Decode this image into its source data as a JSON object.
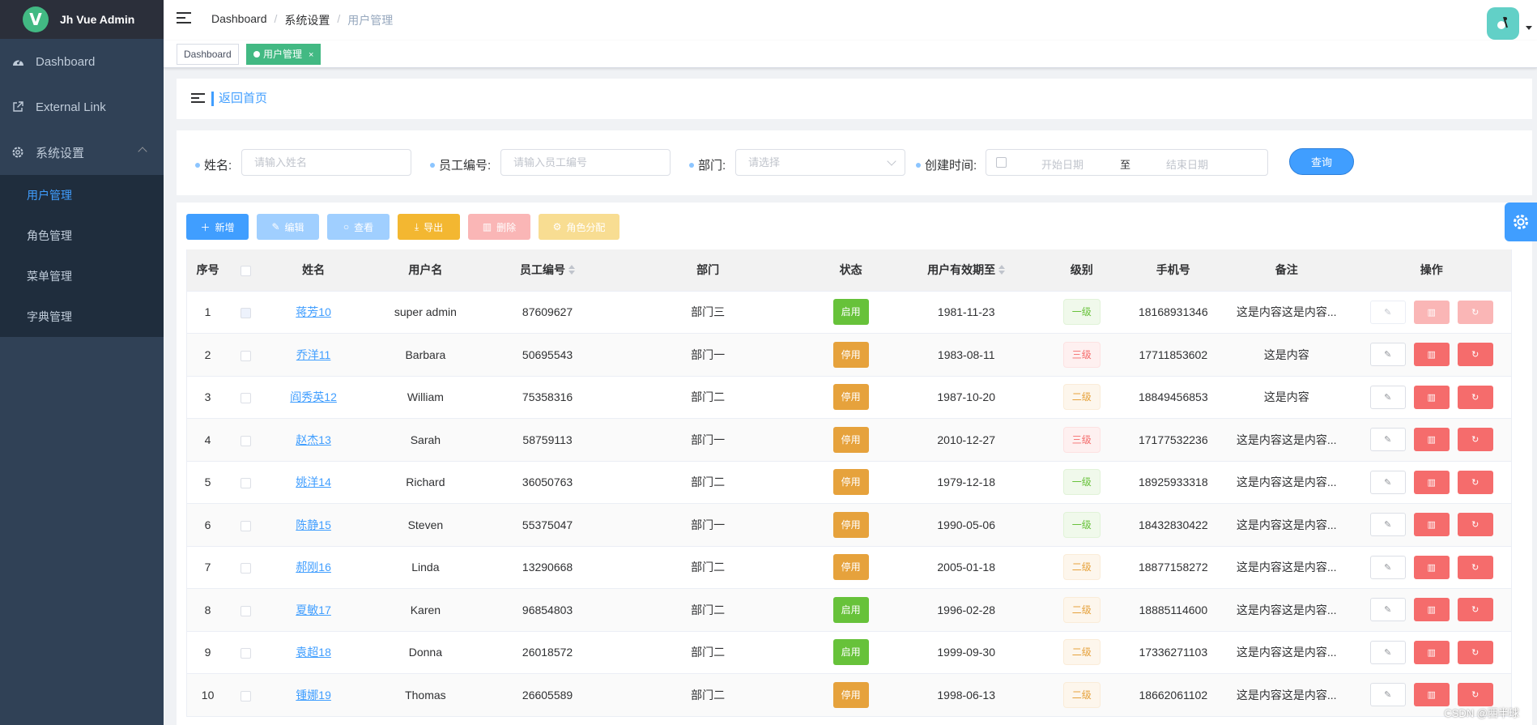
{
  "app": {
    "title": "Jh Vue Admin",
    "logo_letter": "V"
  },
  "sidebar": {
    "items": [
      {
        "label": "Dashboard",
        "icon": "dashboard-icon"
      },
      {
        "label": "External Link",
        "icon": "external-link-icon"
      },
      {
        "label": "系统设置",
        "icon": "gear-icon",
        "expanded": true
      }
    ],
    "submenu": [
      {
        "label": "用户管理",
        "active": true
      },
      {
        "label": "角色管理"
      },
      {
        "label": "菜单管理"
      },
      {
        "label": "字典管理"
      }
    ]
  },
  "header": {
    "breadcrumb": [
      "Dashboard",
      "系统设置",
      "用户管理"
    ]
  },
  "tags": [
    {
      "label": "Dashboard",
      "active": false
    },
    {
      "label": "用户管理",
      "active": true,
      "close": "×"
    }
  ],
  "back": {
    "label": "返回首页"
  },
  "filters": {
    "name": {
      "label": "姓名:",
      "placeholder": "请输入姓名"
    },
    "emp_no": {
      "label": "员工编号:",
      "placeholder": "请输入员工编号"
    },
    "dept": {
      "label": "部门:",
      "placeholder": "请选择"
    },
    "created": {
      "label": "创建时间:",
      "start": "开始日期",
      "sep": "至",
      "end": "结束日期"
    },
    "query_label": "查询"
  },
  "toolbar": {
    "add": "新增",
    "edit": "编辑",
    "view": "查看",
    "export": "导出",
    "delete": "删除",
    "role": "角色分配"
  },
  "colors": {
    "primary": "#409eff",
    "success": "#67c23a",
    "warning": "#e6a23c",
    "danger": "#f56c6c",
    "tag_active": "#42b983",
    "sidebar": "#304156"
  },
  "table": {
    "headers": [
      "序号",
      "",
      "姓名",
      "用户名",
      "员工编号",
      "部门",
      "状态",
      "用户有效期至",
      "级别",
      "手机号",
      "备注",
      "操作"
    ],
    "rows": [
      {
        "idx": "1",
        "name": "蒋芳10",
        "username": "super admin",
        "emp": "87609627",
        "dept": "部门三",
        "status": "启用",
        "expire": "1981-11-23",
        "level": "一级",
        "phone": "18168931346",
        "note": "这是内容这是内容..."
      },
      {
        "idx": "2",
        "name": "乔洋11",
        "username": "Barbara",
        "emp": "50695543",
        "dept": "部门一",
        "status": "停用",
        "expire": "1983-08-11",
        "level": "三级",
        "phone": "17711853602",
        "note": "这是内容"
      },
      {
        "idx": "3",
        "name": "阎秀英12",
        "username": "William",
        "emp": "75358316",
        "dept": "部门二",
        "status": "停用",
        "expire": "1987-10-20",
        "level": "二级",
        "phone": "18849456853",
        "note": "这是内容"
      },
      {
        "idx": "4",
        "name": "赵杰13",
        "username": "Sarah",
        "emp": "58759113",
        "dept": "部门一",
        "status": "停用",
        "expire": "2010-12-27",
        "level": "三级",
        "phone": "17177532236",
        "note": "这是内容这是内容..."
      },
      {
        "idx": "5",
        "name": "姚洋14",
        "username": "Richard",
        "emp": "36050763",
        "dept": "部门二",
        "status": "停用",
        "expire": "1979-12-18",
        "level": "一级",
        "phone": "18925933318",
        "note": "这是内容这是内容..."
      },
      {
        "idx": "6",
        "name": "陈静15",
        "username": "Steven",
        "emp": "55375047",
        "dept": "部门一",
        "status": "停用",
        "expire": "1990-05-06",
        "level": "一级",
        "phone": "18432830422",
        "note": "这是内容这是内容..."
      },
      {
        "idx": "7",
        "name": "郝刚16",
        "username": "Linda",
        "emp": "13290668",
        "dept": "部门二",
        "status": "停用",
        "expire": "2005-01-18",
        "level": "二级",
        "phone": "18877158272",
        "note": "这是内容这是内容..."
      },
      {
        "idx": "8",
        "name": "夏敏17",
        "username": "Karen",
        "emp": "96854803",
        "dept": "部门二",
        "status": "启用",
        "expire": "1996-02-28",
        "level": "二级",
        "phone": "18885114600",
        "note": "这是内容这是内容..."
      },
      {
        "idx": "9",
        "name": "袁超18",
        "username": "Donna",
        "emp": "26018572",
        "dept": "部门二",
        "status": "启用",
        "expire": "1999-09-30",
        "level": "二级",
        "phone": "17336271103",
        "note": "这是内容这是内容..."
      },
      {
        "idx": "10",
        "name": "锺娜19",
        "username": "Thomas",
        "emp": "26605589",
        "dept": "部门二",
        "status": "停用",
        "expire": "1998-06-13",
        "level": "二级",
        "phone": "18662061102",
        "note": "这是内容这是内容..."
      }
    ]
  },
  "watermark": "CSDN @西半球"
}
